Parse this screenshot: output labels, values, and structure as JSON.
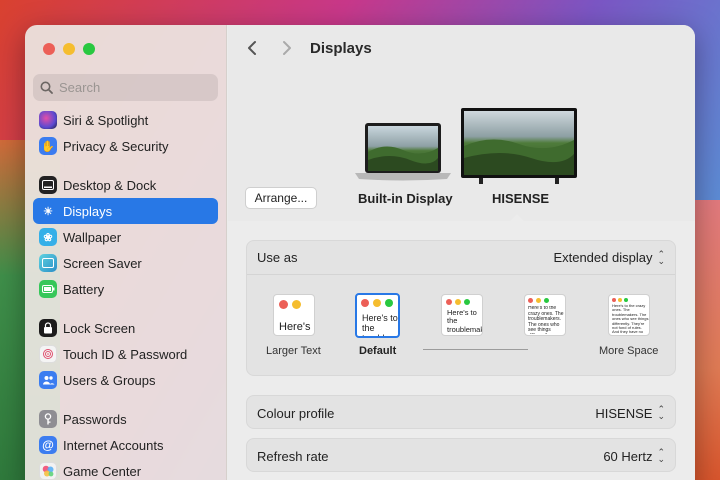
{
  "window": {
    "title": "Displays"
  },
  "sidebar": {
    "search_placeholder": "Search",
    "items": [
      {
        "label": "Siri & Spotlight",
        "icon": "siri-icon",
        "color": "#5b4ad1",
        "active": false
      },
      {
        "label": "Privacy & Security",
        "icon": "hand-icon",
        "color": "#3b7df0",
        "active": false
      },
      {
        "label": "Desktop & Dock",
        "icon": "dock-icon",
        "color": "#222222",
        "active": false
      },
      {
        "label": "Displays",
        "icon": "sun-icon",
        "color": "#2878e6",
        "active": true
      },
      {
        "label": "Wallpaper",
        "icon": "flower-icon",
        "color": "#34b0e8",
        "active": false
      },
      {
        "label": "Screen Saver",
        "icon": "screensaver-icon",
        "color": "#3ab7c9",
        "active": false
      },
      {
        "label": "Battery",
        "icon": "battery-icon",
        "color": "#35c759",
        "active": false
      },
      {
        "label": "Lock Screen",
        "icon": "lock-icon",
        "color": "#1c1c1c",
        "active": false
      },
      {
        "label": "Touch ID & Password",
        "icon": "fingerprint-icon",
        "color": "#f2f2f2",
        "active": false
      },
      {
        "label": "Users & Groups",
        "icon": "users-icon",
        "color": "#3b7df0",
        "active": false
      },
      {
        "label": "Passwords",
        "icon": "key-icon",
        "color": "#8e8e93",
        "active": false
      },
      {
        "label": "Internet Accounts",
        "icon": "at-icon",
        "color": "#3b7df0",
        "active": false
      },
      {
        "label": "Game Center",
        "icon": "game-center-icon",
        "color": "#e0e0e0",
        "active": false
      }
    ]
  },
  "header": {
    "arrange_label": "Arrange...",
    "displays": [
      "Built-in Display",
      "HISENSE"
    ]
  },
  "use_as": {
    "label": "Use as",
    "value": "Extended display",
    "resolutions": [
      {
        "label": "Larger Text",
        "sample": "Here's"
      },
      {
        "label": "Default",
        "sample": "Here's to the troublemakers. The ones who"
      },
      {
        "label": "",
        "sample": "Here's to the troublemakers. The ones who"
      },
      {
        "label": "",
        "sample": "Here's to the crazy ones. The troublemakers. The ones who see things differently."
      },
      {
        "label": "More Space",
        "sample": "Here's to the crazy ones. The troublemakers. The ones who see things differently. They're not fond of rules. And they have no respect"
      }
    ]
  },
  "colour_profile": {
    "label": "Colour profile",
    "value": "HISENSE"
  },
  "refresh_rate": {
    "label": "Refresh rate",
    "value": "60 Hertz"
  }
}
